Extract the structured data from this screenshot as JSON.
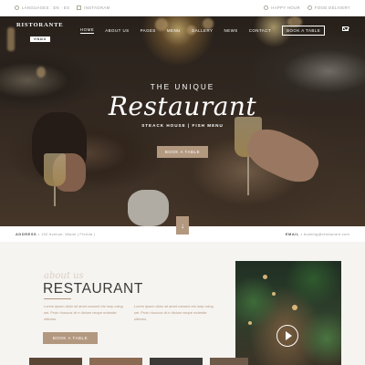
{
  "topbar": {
    "left": [
      "LANGUAGES : EN · ES",
      "INSTAGRAM"
    ],
    "right": [
      "HAPPY HOUR",
      "FOOD DELIVERY"
    ]
  },
  "logo": {
    "name": "RISTORANTE",
    "tag": "VINAIO"
  },
  "nav": {
    "items": [
      "HOME",
      "ABOUT US",
      "PAGES",
      "MENU",
      "GALLERY",
      "NEWS",
      "CONTACT"
    ],
    "book": "BOOK A TABLE",
    "active": "HOME"
  },
  "hero": {
    "pre": "THE UNIQUE",
    "title": "Restaurant",
    "subtitle": "STEACK HOUSE | FISH MENU",
    "button": "BOOK A TABLE"
  },
  "address_bar": {
    "address_label": "ADDRESS :",
    "address": "192 Avenue, Miami | Florida |",
    "email_label": "EMAIL :",
    "email": "booking@restaurant.com"
  },
  "about": {
    "script": "about us",
    "title": "RESTAURANT",
    "col1": "Lorem ipsum dolor sit amet consect eto loep ocing set. Proin rhoncus vit e dictum neque molestie ultricies.",
    "col2": "Lorem ipsum dolor sit amet consect eto loep ocing set. Proin rhoncus vit e dictum neque molestie ultricies.",
    "button": "BOOK A TABLE"
  },
  "colors": {
    "accent": "#b39880",
    "background": "#f6f4f1"
  }
}
